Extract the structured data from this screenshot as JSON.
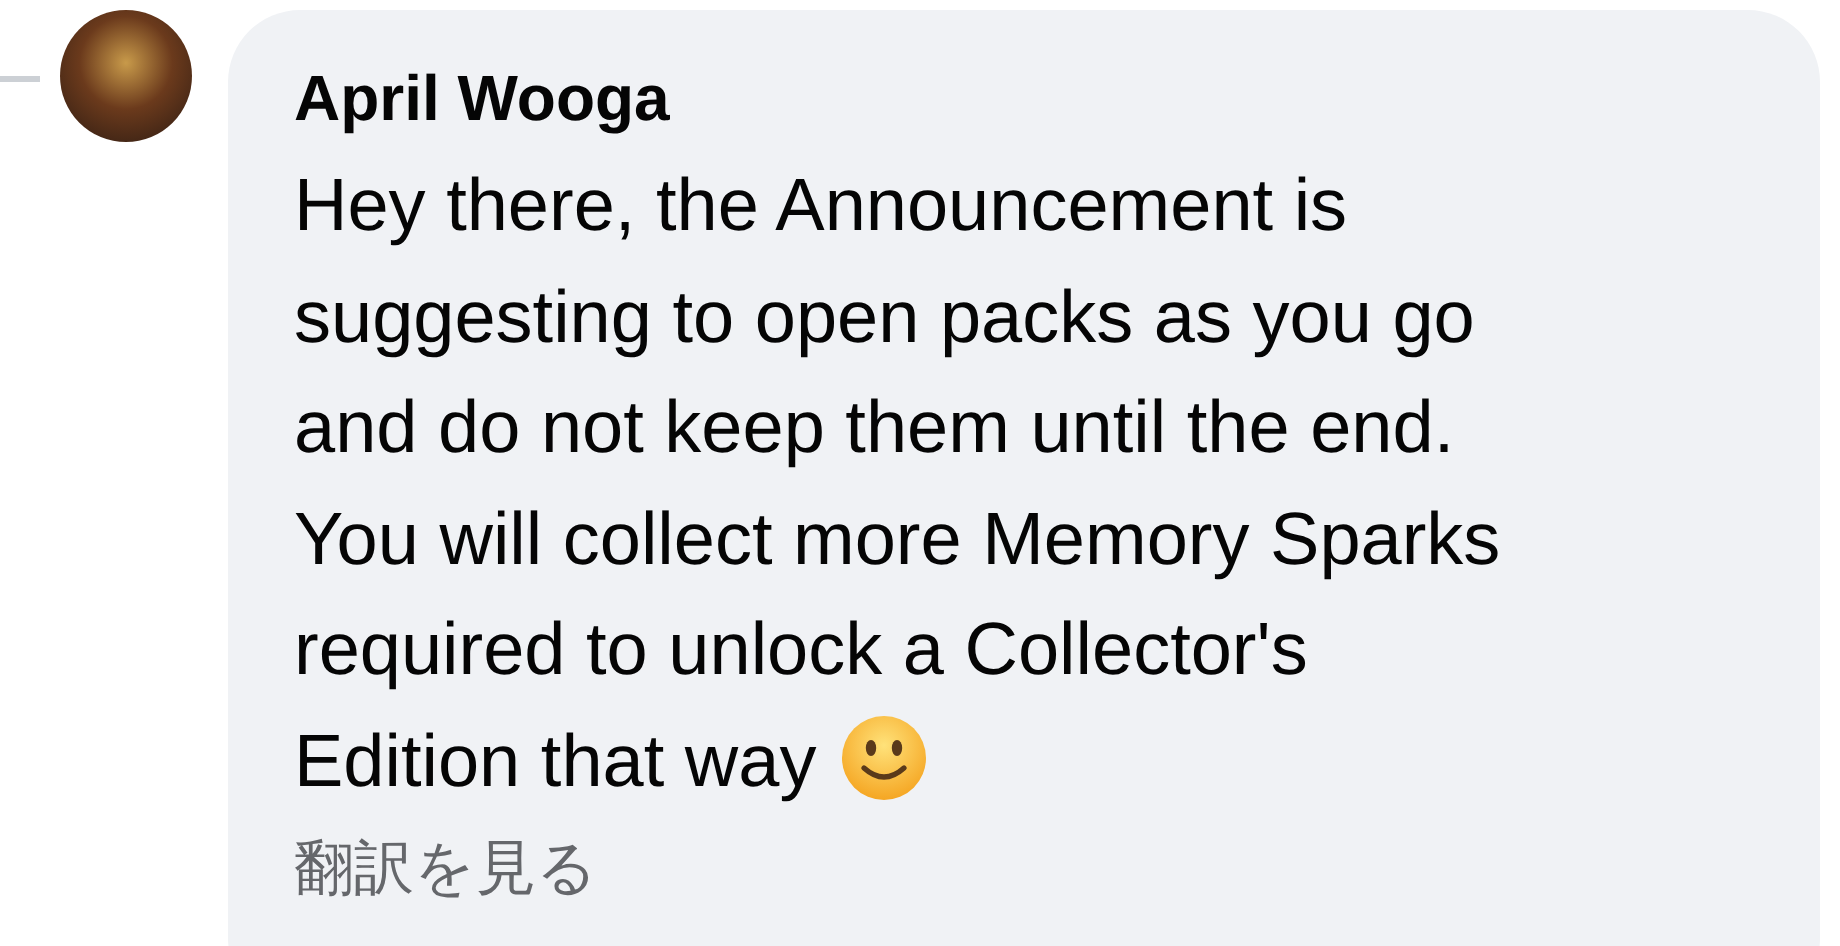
{
  "comment": {
    "author": "April Wooga",
    "lines": [
      "Hey there, the Announcement is",
      "suggesting to open packs as you go",
      "and do not keep them until the end.",
      "You will collect more Memory Sparks",
      "required to unlock a Collector's",
      "Edition that way"
    ],
    "translate_link": "翻訳を見る"
  }
}
